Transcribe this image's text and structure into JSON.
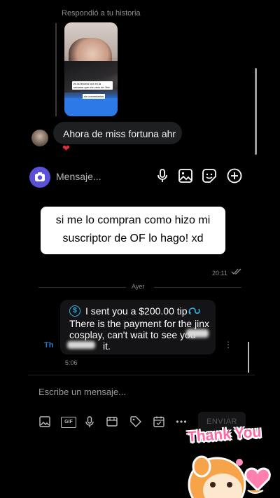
{
  "story": {
    "replied_label": "Respondió a tu historia",
    "caption_line1": "es la tercera vez en la semana que me visto de Jinx",
    "caption_line2": "sin comentarios"
  },
  "dm": {
    "message": "Ahora de miss fortuna ahr",
    "reaction": "❤"
  },
  "ig_composer": {
    "placeholder": "Mensaje...",
    "icons": [
      "camera-icon",
      "mic-icon",
      "gallery-icon",
      "sticker-icon",
      "plus-icon"
    ],
    "accent": "#5b51d8"
  },
  "overlay_caption": {
    "line1": "si me lo compran como hizo mi",
    "line2": "suscriptor de OF lo hago! xd"
  },
  "chat": {
    "sent_time": "20:11",
    "day_divider": "Ayer",
    "tip": {
      "title": "I sent you a $200.00 tip",
      "body_line1": "There is the payment for the jinx",
      "body_line2": "cosplay, can't wait to see you",
      "body_line3": "it."
    },
    "sender_initials": "Th",
    "tip_time": "5:06",
    "more": "⋮"
  },
  "composer": {
    "placeholder": "Escribe un mensaje...",
    "send_label": "ENVIAR",
    "tools": [
      "image-icon",
      "gif-icon",
      "mic-icon",
      "media-icon",
      "tag-icon",
      "calendar-icon",
      "more-icon"
    ],
    "gif_label": "GIF"
  },
  "sticker": {
    "text": "Thank You"
  },
  "colors": {
    "tip_icon": "#35b3e6",
    "sender": "#2a7ac9",
    "sticker_pink": "#ff6aa6"
  }
}
